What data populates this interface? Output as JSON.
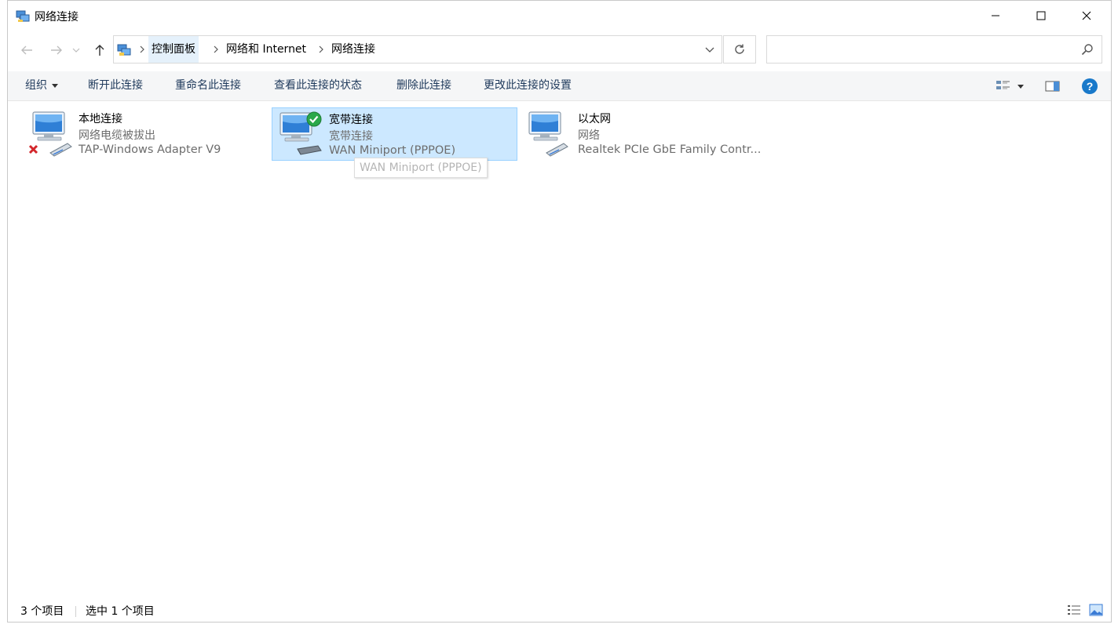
{
  "window": {
    "title": "网络连接"
  },
  "breadcrumb": [
    "控制面板",
    "网络和 Internet",
    "网络连接"
  ],
  "search": {
    "placeholder": ""
  },
  "commands": {
    "organize": "组织",
    "disconnect": "断开此连接",
    "rename": "重命名此连接",
    "view_status": "查看此连接的状态",
    "delete": "删除此连接",
    "change_settings": "更改此连接的设置"
  },
  "items": [
    {
      "name": "本地连接",
      "status": "网络电缆被拔出",
      "device": "TAP-Windows Adapter V9",
      "icon": "network-disconnected-icon"
    },
    {
      "name": "宽带连接",
      "status": "宽带连接",
      "device": "WAN Miniport (PPPOE)",
      "icon": "broadband-connected-icon"
    },
    {
      "name": "以太网",
      "status": "网络",
      "device": "Realtek PCIe GbE Family Contr...",
      "icon": "ethernet-icon"
    }
  ],
  "tooltip": "WAN Miniport (PPPOE)",
  "status": {
    "count": "3 个项目",
    "selected": "选中 1 个项目"
  },
  "colors": {
    "selection_bg": "#cce8ff",
    "selection_border": "#99d1ff",
    "help_blue": "#1979ca",
    "command_text": "#1e395b"
  }
}
